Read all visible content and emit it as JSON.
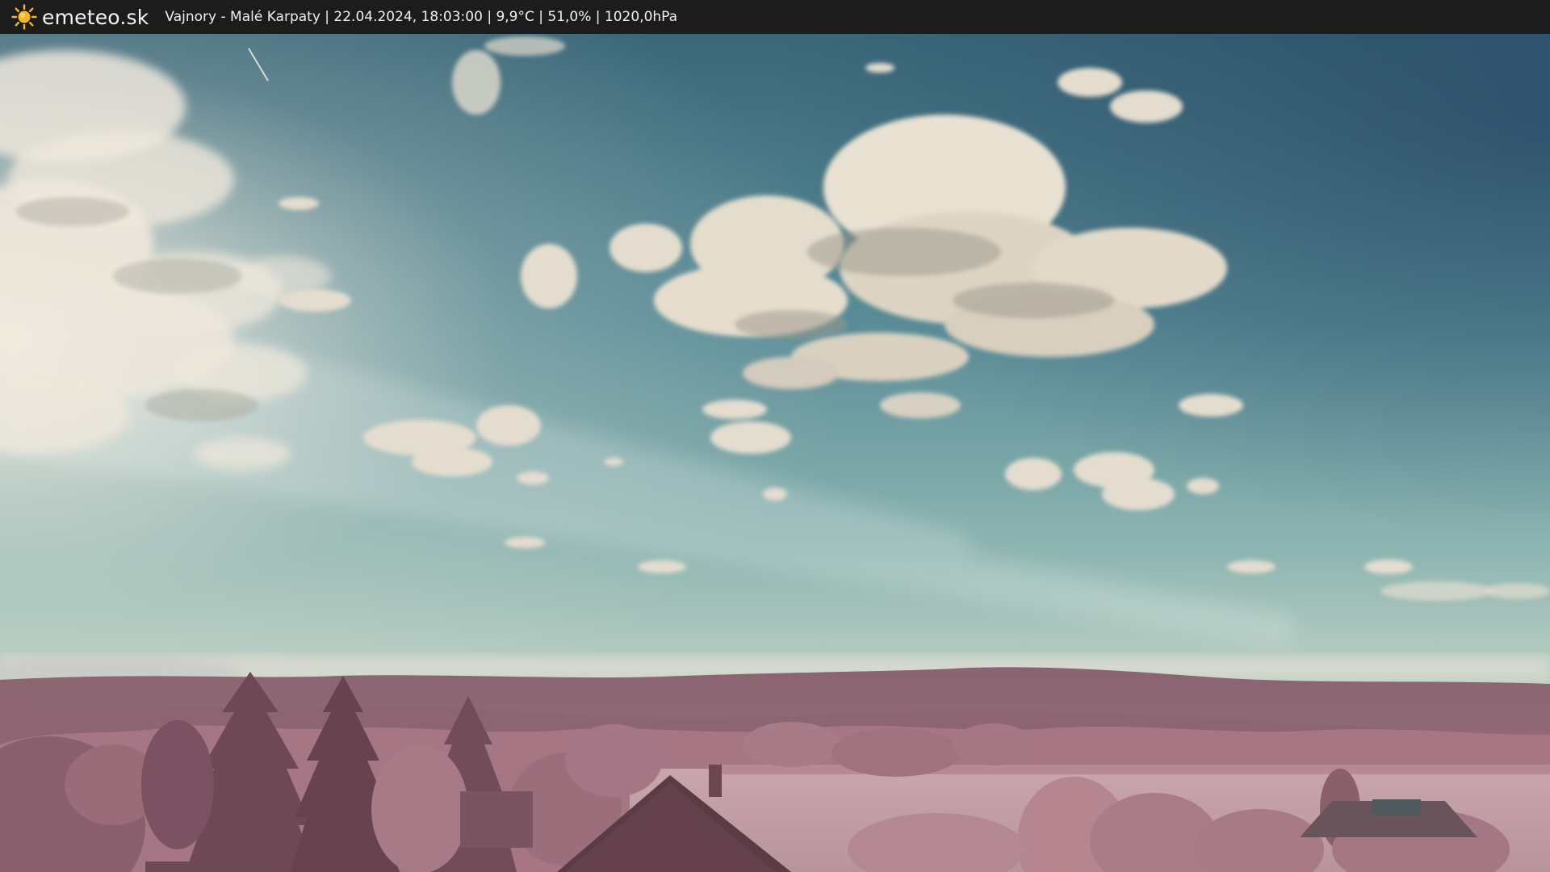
{
  "header": {
    "brand": "emeteo.sk",
    "logo_icon": "sun-icon",
    "info": "Vajnory - Malé Karpaty | 22.04.2024, 18:03:00 | 9,9°C | 51,0% | 1020,0hPa"
  },
  "colors": {
    "header_bg": "#1c1c1c",
    "sun": "#f7b52a",
    "sky_top": "#3d6f80",
    "sky_horizon": "#cfd9c8",
    "foliage": "#b07f90"
  }
}
